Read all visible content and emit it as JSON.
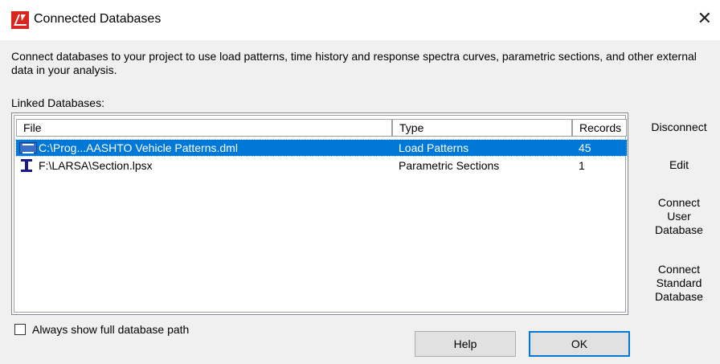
{
  "window": {
    "title": "Connected Databases",
    "close_glyph": "✕",
    "app_icon": "larsa-logo-icon"
  },
  "description": "Connect databases to your project to use load patterns, time history and response spectra curves, parametric sections, and other external data in your analysis.",
  "linked_label": "Linked Databases:",
  "table": {
    "columns": [
      "File",
      "Type",
      "Records"
    ],
    "rows": [
      {
        "file": "C:\\Prog...AASHTO Vehicle Patterns.dml",
        "type": "Load Patterns",
        "records": "45",
        "icon": "load-pattern-icon",
        "selected": true
      },
      {
        "file": "F:\\LARSA\\Section.lpsx",
        "type": "Parametric Sections",
        "records": "1",
        "icon": "i-beam-section-icon",
        "selected": false
      }
    ]
  },
  "side_buttons": {
    "disconnect": "Disconnect",
    "edit": "Edit",
    "connect_user": [
      "Connect",
      "User",
      "Database"
    ],
    "connect_standard": [
      "Connect",
      "Standard",
      "Database"
    ]
  },
  "checkbox": {
    "label": "Always show full database path",
    "checked": false
  },
  "buttons": {
    "help": "Help",
    "ok": "OK"
  },
  "colors": {
    "selection": "#0078d7",
    "ok_border": "#0078d7",
    "background": "#f0f0f0"
  }
}
